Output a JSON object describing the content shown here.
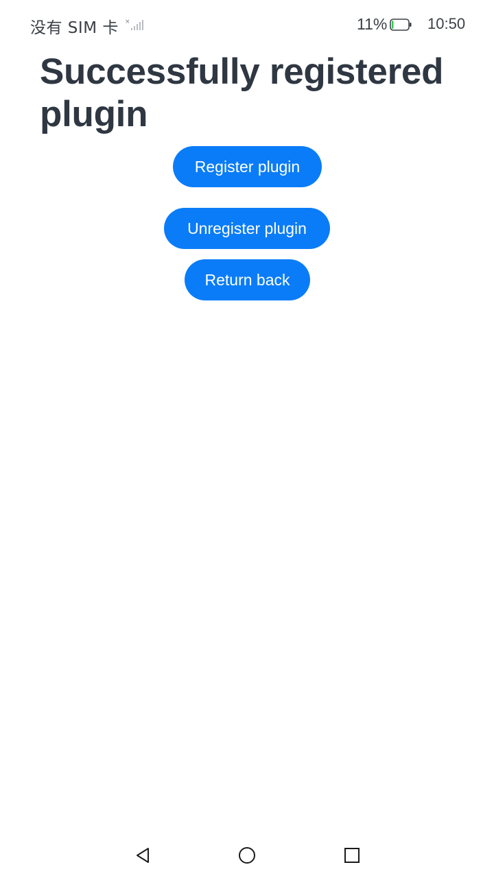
{
  "status_bar": {
    "carrier": "没有 SIM 卡",
    "battery_percent": "11%",
    "battery_level": 0.11,
    "time": "10:50"
  },
  "page": {
    "title": "Successfully registered plugin"
  },
  "buttons": {
    "register": "Register plugin",
    "unregister": "Unregister plugin",
    "back": "Return back"
  },
  "colors": {
    "accent": "#0a7cf8",
    "title_text": "#2f3742",
    "background": "#ffffff"
  },
  "icons": {
    "signal": "signal-icon",
    "battery": "battery-icon",
    "nav_back": "back-triangle-icon",
    "nav_home": "home-circle-icon",
    "nav_recent": "recent-square-icon"
  }
}
